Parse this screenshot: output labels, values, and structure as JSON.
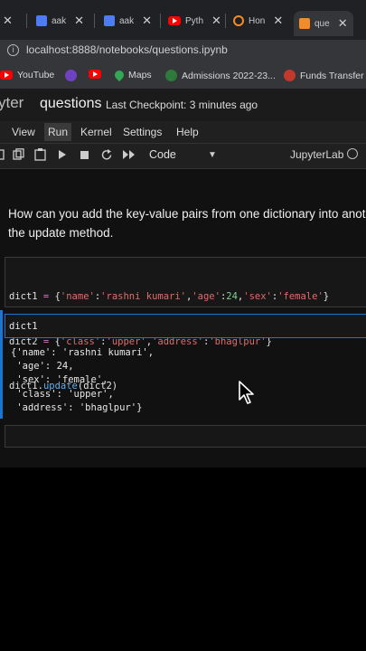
{
  "browser": {
    "tabs": [
      {
        "label": "aak",
        "favicon": "#4d7cf4"
      },
      {
        "label": "aak",
        "favicon": "#4d7cf4"
      },
      {
        "label": "Pyth",
        "favicon": "#ff0000"
      },
      {
        "label": "Hon",
        "favicon": "#f28c28"
      },
      {
        "label": "que",
        "favicon": "#f28c28"
      }
    ],
    "address": "localhost:8888/notebooks/questions.ipynb",
    "bookmarks": [
      "YouTube",
      "Maps",
      "Admissions 2022-23...",
      "Funds Transfer"
    ]
  },
  "jupyter": {
    "logo_text": "yter",
    "notebook_name": "questions",
    "checkpoint": "Last Checkpoint: 3 minutes ago",
    "menu": [
      "View",
      "Run",
      "Kernel",
      "Settings",
      "Help"
    ],
    "cell_type": "Code",
    "kernel_label": "JupyterLab"
  },
  "cells": {
    "markdown_line1": "How can you add the key-value pairs from one dictionary into anot",
    "markdown_line2": "the update method.",
    "code1": {
      "line1_parts": [
        "dict1",
        " = ",
        "{",
        "'name'",
        ":",
        "'rashni kumari'",
        ",",
        "'age'",
        ":",
        "24",
        ",",
        "'sex'",
        ":",
        "'female'",
        "}"
      ],
      "line2_parts": [
        "dict2",
        " = ",
        "{",
        "'class'",
        ":",
        "'upper'",
        ",",
        "'address'",
        ":",
        "'bhaglpur'",
        "}"
      ],
      "line3_parts": [
        "dict1.",
        "update",
        "(dict2)"
      ]
    },
    "code2": "dict1",
    "output": "{'name': 'rashni kumari',\n 'age': 24,\n 'sex': 'female',\n 'class': 'upper',\n 'address': 'bhaglpur'}"
  }
}
